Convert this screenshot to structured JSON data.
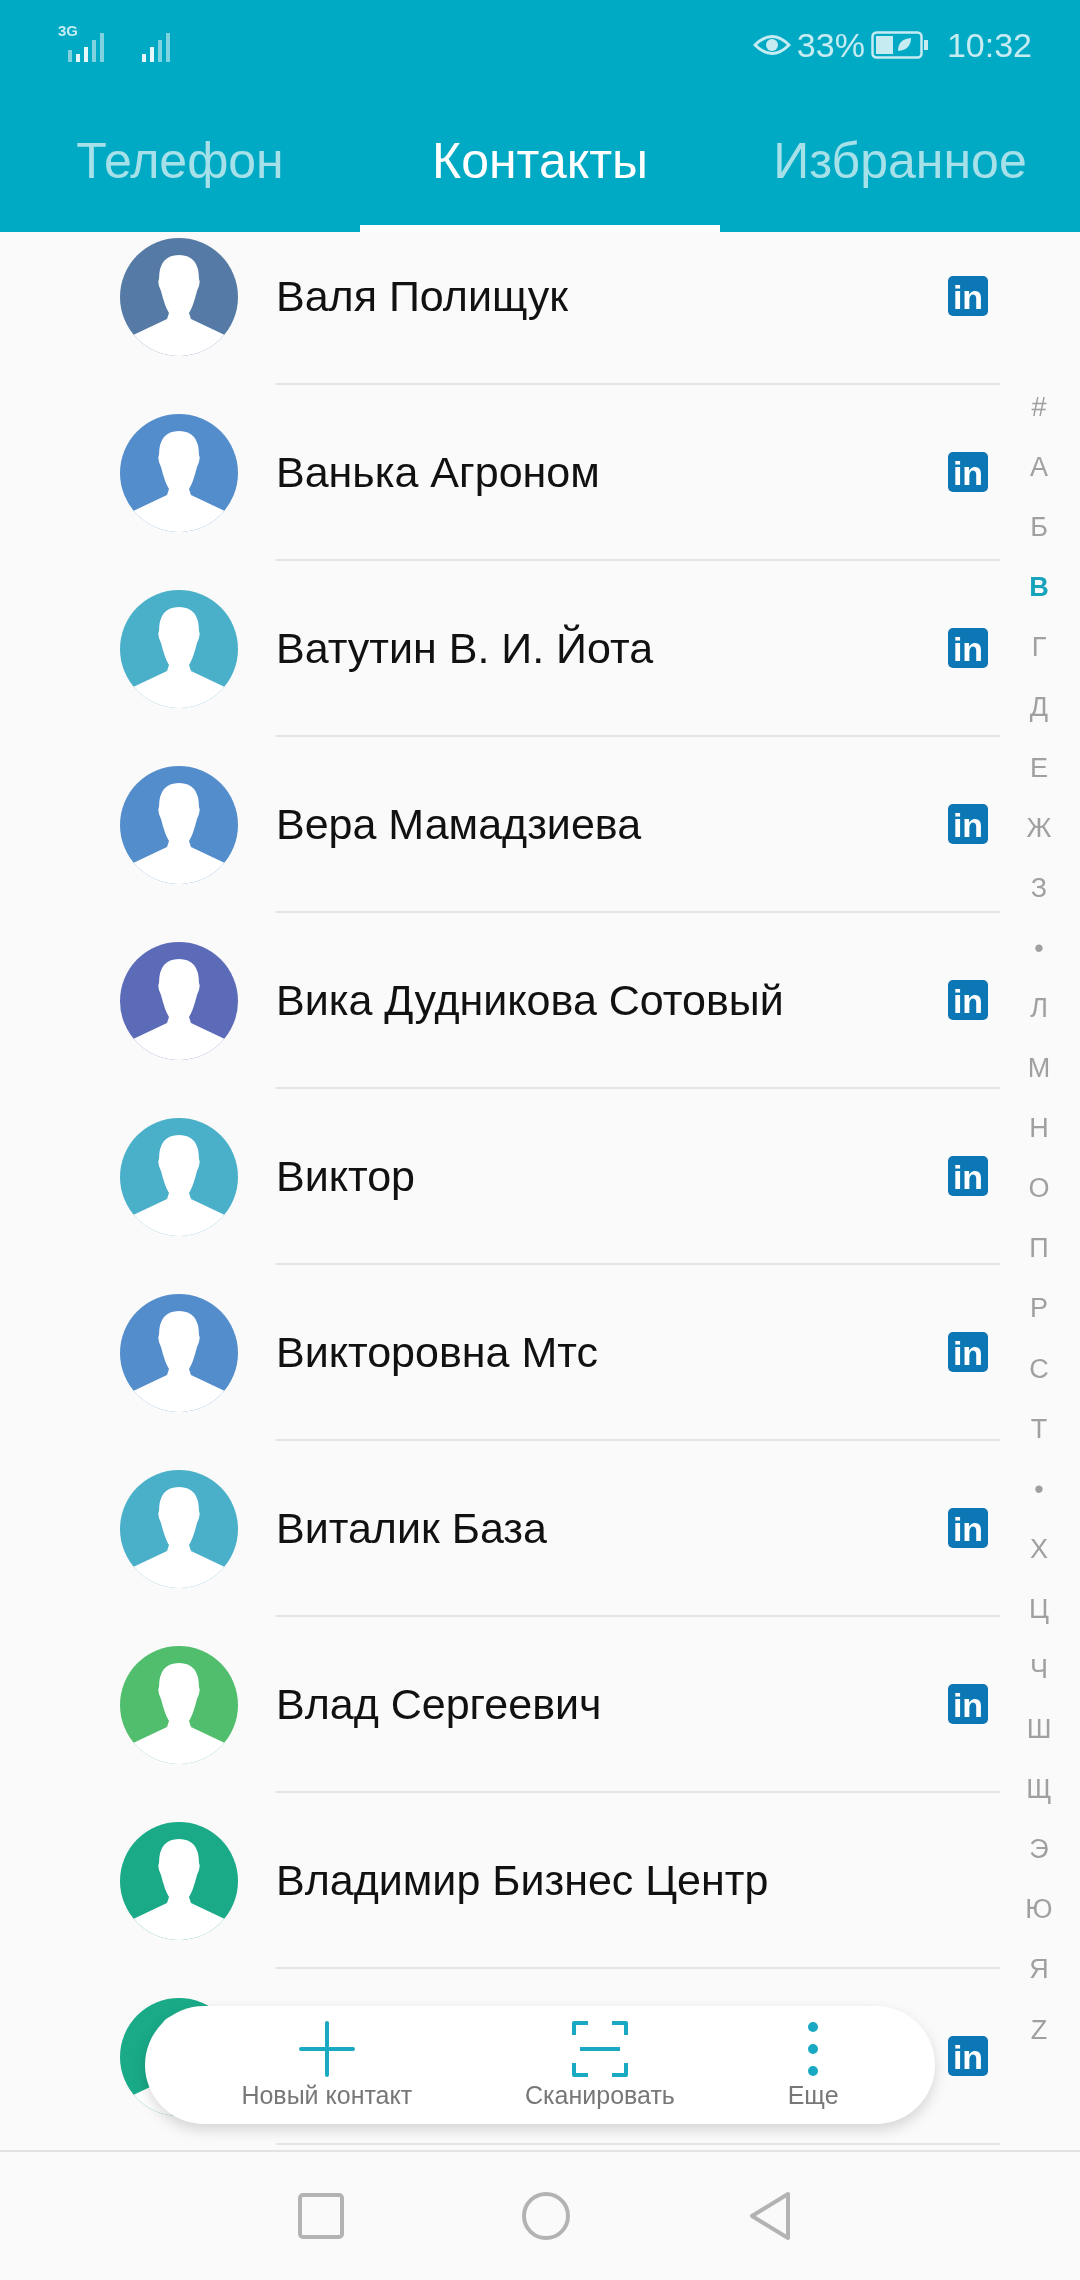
{
  "status_bar": {
    "network": "3G",
    "battery": "33%",
    "time": "10:32"
  },
  "tabs": [
    {
      "label": "Телефон",
      "selected": false
    },
    {
      "label": "Контакты",
      "selected": true
    },
    {
      "label": "Избранное",
      "selected": false
    }
  ],
  "contacts": [
    {
      "name": "Валя Полищук",
      "color": "#547aa5",
      "badge": "in"
    },
    {
      "name": "Ванька Агроном",
      "color": "#548dcc",
      "badge": "in"
    },
    {
      "name": "Ватутин В. И. Йота",
      "color": "#4ab0c9",
      "badge": "in"
    },
    {
      "name": "Вера Мамадзиева",
      "color": "#548dcc",
      "badge": "in"
    },
    {
      "name": "Вика Дудникова Сотовый",
      "color": "#5c6bb8",
      "badge": "in"
    },
    {
      "name": "Виктор",
      "color": "#4ab0c9",
      "badge": "in"
    },
    {
      "name": "Викторовна Мтс",
      "color": "#548dcc",
      "badge": "in"
    },
    {
      "name": "Виталик База",
      "color": "#4ab0c9",
      "badge": "in"
    },
    {
      "name": "Влад Сергеевич",
      "color": "#51be6e",
      "badge": "in"
    },
    {
      "name": "Владимир Бизнес Центр",
      "color": "#1aaa88"
    },
    {
      "color": "#1aaa88",
      "badge": "in"
    }
  ],
  "index": [
    {
      "label": "#",
      "selected": false
    },
    {
      "label": "А",
      "selected": false
    },
    {
      "label": "Б",
      "selected": false
    },
    {
      "label": "В",
      "selected": true
    },
    {
      "label": "Г",
      "selected": false
    },
    {
      "label": "Д",
      "selected": false
    },
    {
      "label": "Е",
      "selected": false
    },
    {
      "label": "Ж",
      "selected": false
    },
    {
      "label": "З",
      "selected": false
    },
    {
      "label": "•",
      "selected": false
    },
    {
      "label": "Л",
      "selected": false
    },
    {
      "label": "М",
      "selected": false
    },
    {
      "label": "Н",
      "selected": false
    },
    {
      "label": "О",
      "selected": false
    },
    {
      "label": "П",
      "selected": false
    },
    {
      "label": "Р",
      "selected": false
    },
    {
      "label": "С",
      "selected": false
    },
    {
      "label": "Т",
      "selected": false
    },
    {
      "label": "•",
      "selected": false
    },
    {
      "label": "Х",
      "selected": false
    },
    {
      "label": "Ц",
      "selected": false
    },
    {
      "label": "Ч",
      "selected": false
    },
    {
      "label": "Ш",
      "selected": false
    },
    {
      "label": "Щ",
      "selected": false
    },
    {
      "label": "Э",
      "selected": false
    },
    {
      "label": "Ю",
      "selected": false
    },
    {
      "label": "Я",
      "selected": false
    },
    {
      "label": "Z",
      "selected": false
    }
  ],
  "actions": [
    {
      "kind": "add",
      "label": "Новый контакт"
    },
    {
      "kind": "scan",
      "label": "Сканировать"
    },
    {
      "kind": "more",
      "label": "Еще"
    }
  ]
}
